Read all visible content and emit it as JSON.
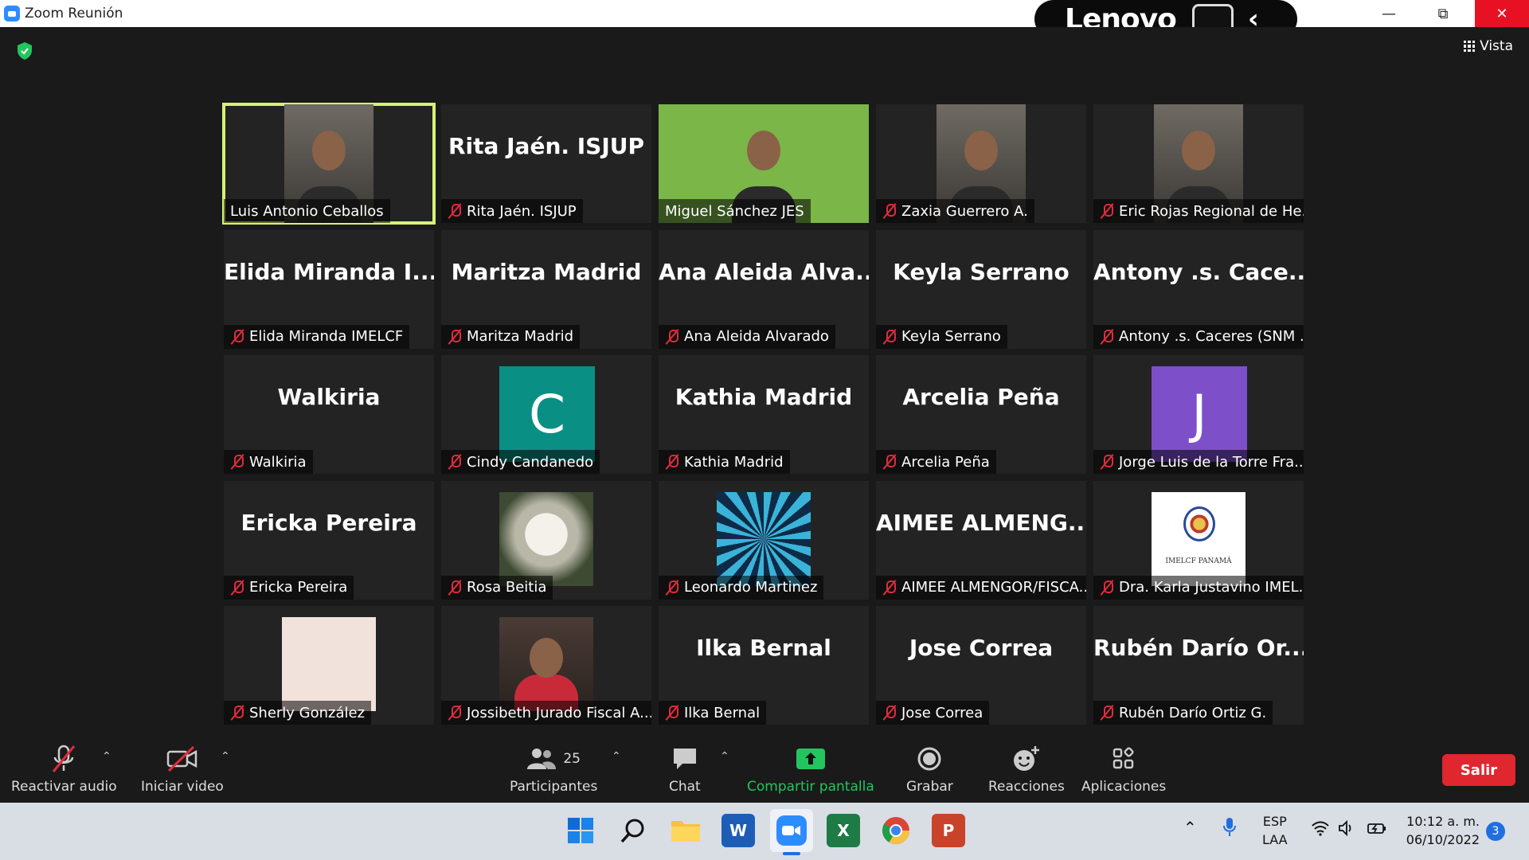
{
  "window": {
    "title": "Zoom Reunión",
    "brand": "Lenovo"
  },
  "view_button": {
    "label": "Vista"
  },
  "tiles": [
    {
      "display_name": "",
      "label": "Luis Antonio Ceballos",
      "muted": false,
      "active": true,
      "kind": "video"
    },
    {
      "display_name": "Rita Jaén. ISJUP",
      "label": "Rita Jaén. ISJUP",
      "muted": true,
      "kind": "name"
    },
    {
      "display_name": "",
      "label": "Miguel Sánchez JES",
      "muted": false,
      "kind": "video-green"
    },
    {
      "display_name": "",
      "label": "Zaxia Guerrero A.",
      "muted": true,
      "kind": "video"
    },
    {
      "display_name": "",
      "label": "Eric Rojas Regional de He...",
      "muted": true,
      "kind": "video"
    },
    {
      "display_name": "Elida Miranda I...",
      "label": "Elida Miranda IMELCF",
      "muted": true,
      "kind": "name"
    },
    {
      "display_name": "Maritza Madrid",
      "label": "Maritza Madrid",
      "muted": true,
      "kind": "name"
    },
    {
      "display_name": "Ana Aleida Alva...",
      "label": "Ana Aleida Alvarado",
      "muted": true,
      "kind": "name"
    },
    {
      "display_name": "Keyla Serrano",
      "label": "Keyla Serrano",
      "muted": true,
      "kind": "name"
    },
    {
      "display_name": "Antony .s. Cace...",
      "label": "Antony .s. Caceres (SNM ...",
      "muted": true,
      "kind": "name"
    },
    {
      "display_name": "Walkiria",
      "label": "Walkiria",
      "muted": true,
      "kind": "name"
    },
    {
      "display_name": "C",
      "label": "Cindy Candanedo",
      "muted": true,
      "kind": "avatar",
      "color": "#0a8f84"
    },
    {
      "display_name": "Kathia Madrid",
      "label": "Kathia Madrid",
      "muted": true,
      "kind": "name"
    },
    {
      "display_name": "Arcelia Peña",
      "label": "Arcelia Peña",
      "muted": true,
      "kind": "name"
    },
    {
      "display_name": "J",
      "label": "Jorge Luis de la Torre Fra...",
      "muted": true,
      "kind": "avatar",
      "color": "#7d4fc9"
    },
    {
      "display_name": "Ericka Pereira",
      "label": "Ericka Pereira",
      "muted": true,
      "kind": "name"
    },
    {
      "display_name": "",
      "label": "Rosa Beitia",
      "muted": true,
      "kind": "photo-flower"
    },
    {
      "display_name": "",
      "label": "Leonardo Martinez",
      "muted": true,
      "kind": "photo-ninja"
    },
    {
      "display_name": "AIMEE ALMENG...",
      "label": "AIMEE ALMENGOR/FISCA...",
      "muted": true,
      "kind": "name"
    },
    {
      "display_name": "",
      "label": "Dra. Karla Justavino IMEL...",
      "muted": true,
      "kind": "photo-logo",
      "logo_text": "IMELCF PANAMÁ"
    },
    {
      "display_name": "",
      "label": "Sherly González",
      "muted": true,
      "kind": "photo-drawing"
    },
    {
      "display_name": "",
      "label": "Jossibeth Jurado Fiscal A...",
      "muted": true,
      "kind": "photo-person"
    },
    {
      "display_name": "Ilka Bernal",
      "label": "Ilka Bernal",
      "muted": true,
      "kind": "name"
    },
    {
      "display_name": "Jose Correa",
      "label": "Jose Correa",
      "muted": true,
      "kind": "name"
    },
    {
      "display_name": "Rubén Darío Or...",
      "label": "Rubén Darío Ortiz G.",
      "muted": true,
      "kind": "name"
    }
  ],
  "toolbar": {
    "audio": "Reactivar audio",
    "video": "Iniciar video",
    "participants": "Participantes",
    "participants_count": "25",
    "chat": "Chat",
    "share": "Compartir pantalla",
    "record": "Grabar",
    "reactions": "Reacciones",
    "apps": "Aplicaciones",
    "leave": "Salir"
  },
  "tray": {
    "lang1": "ESP",
    "lang2": "LAA",
    "time": "10:12 a. m.",
    "date": "06/10/2022",
    "notif": "3"
  },
  "colors": {
    "active_border": "#d6f275",
    "share_green": "#23c55e",
    "leave_red": "#e0262f",
    "muted_red": "#e02b3c"
  }
}
